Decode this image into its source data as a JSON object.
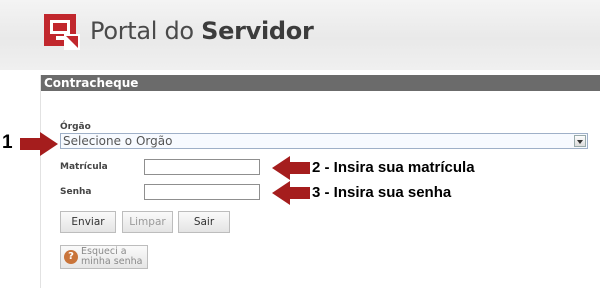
{
  "header": {
    "brand_regular": "Portal do ",
    "brand_bold": "Servidor",
    "logo_icon": "red-monitor-logo-icon",
    "brand_color": "#c1272d"
  },
  "panel": {
    "title": "Contracheque"
  },
  "form": {
    "orgao_label": "Órgão",
    "orgao_selected": "Selecione o Orgão",
    "matricula_label": "Matrícula",
    "matricula_value": "",
    "senha_label": "Senha",
    "senha_value": "",
    "buttons": {
      "enviar": "Enviar",
      "limpar": "Limpar",
      "sair": "Sair"
    },
    "forgot_label": "Esqueci a minha senha",
    "forgot_icon": "help-question-icon"
  },
  "annotations": {
    "step1": "1",
    "step2": "2 - Insira sua matrícula",
    "step3": "3 - Insira sua senha",
    "arrow_color": "#a51d1d"
  }
}
